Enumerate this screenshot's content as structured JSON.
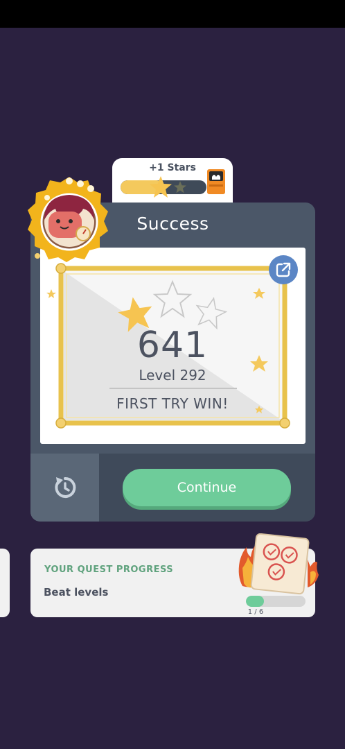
{
  "stars_reward": {
    "label": "+1 Stars",
    "progress": 0.5
  },
  "result": {
    "title": "Success",
    "score": "641",
    "level": "Level 292",
    "message": "FIRST TRY WIN!",
    "stars_earned": 1,
    "stars_total": 3
  },
  "actions": {
    "continue_label": "Continue"
  },
  "quest": {
    "heading": "YOUR QUEST PROGRESS",
    "task": "Beat levels",
    "progress_text": "1 / 6",
    "progress": 0.17
  },
  "colors": {
    "background": "#2b2140",
    "card": "#4b5768",
    "accent_green": "#6ecc9a",
    "star_gold": "#f4c95d",
    "share_blue": "#5b86c5"
  },
  "icons": [
    "share-icon",
    "retry-icon",
    "star-icon",
    "chest-icon",
    "avatar-badge",
    "quest-badge"
  ]
}
